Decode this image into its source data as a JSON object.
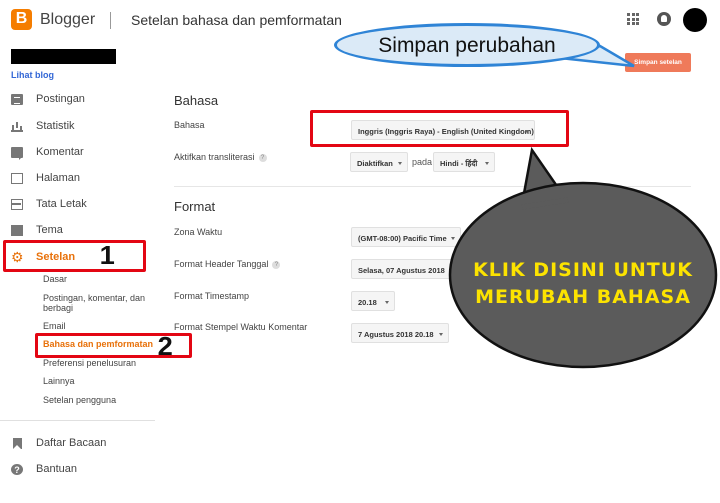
{
  "app": {
    "brand": "Blogger",
    "logo_letter": "B",
    "page_title": "Setelan bahasa dan pemformatan",
    "view_blog": "Lihat blog"
  },
  "sidebar": {
    "items": [
      {
        "label": "Postingan",
        "icon": "posts-icon"
      },
      {
        "label": "Statistik",
        "icon": "stats-icon"
      },
      {
        "label": "Komentar",
        "icon": "comment-icon"
      },
      {
        "label": "Halaman",
        "icon": "page-icon"
      },
      {
        "label": "Tata Letak",
        "icon": "layout-icon"
      },
      {
        "label": "Tema",
        "icon": "theme-icon"
      },
      {
        "label": "Setelan",
        "icon": "gear-icon",
        "active": true
      }
    ],
    "sub_items": [
      "Dasar",
      "Postingan, komentar, dan berbagi",
      "Email",
      "Bahasa dan pemformatan",
      "Preferensi penelusuran",
      "Lainnya",
      "Setelan pengguna"
    ],
    "bottom_items": [
      {
        "label": "Daftar Bacaan",
        "icon": "bookmark-icon"
      },
      {
        "label": "Bantuan",
        "icon": "help-icon",
        "glyph": "?"
      }
    ]
  },
  "toolbar": {
    "save_label": "Simpan setelan"
  },
  "language": {
    "heading": "Bahasa",
    "language_label": "Bahasa",
    "language_value": "Inggris (Inggris Raya) - English (United Kingdom)",
    "translit_label": "Aktifkan transliterasi",
    "translit_value": "Diaktifkan",
    "pada": "pada",
    "translit_lang": "Hindi - हिंदी",
    "help_glyph": "?"
  },
  "format": {
    "heading": "Format",
    "timezone_label": "Zona Waktu",
    "timezone_value": "(GMT-08:00) Pacific Time",
    "date_header_label": "Format Header Tanggal",
    "date_header_value": "Selasa, 07 Agustus 2018",
    "timestamp_label": "Format Timestamp",
    "timestamp_value": "20.18",
    "comment_stamp_label": "Format Stempel Waktu Komentar",
    "comment_stamp_value": "7 Agustus 2018 20.18"
  },
  "annotations": {
    "step1": "1",
    "step2": "2",
    "callout_save": "Simpan perubahan",
    "callout_lang_line1": "KLIK DISINI UNTUK",
    "callout_lang_line2": "MERUBAH BAHASA"
  },
  "colors": {
    "accent": "#e8710a",
    "save_button": "#ef7a5a",
    "highlight_box": "#e30613",
    "callout_fill": "#5b5b5b",
    "callout_text": "#fce300",
    "callout_top_fill": "#dbeaf7",
    "callout_top_border": "#2f84d6"
  }
}
